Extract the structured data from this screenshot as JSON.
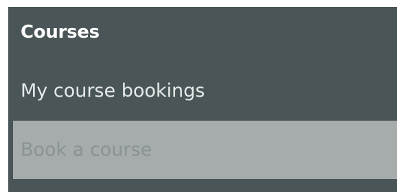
{
  "nav": {
    "heading": "Courses",
    "items": [
      {
        "label": "My course bookings",
        "state": "default"
      },
      {
        "label": "Book a course",
        "state": "selected"
      }
    ]
  },
  "colors": {
    "panel_background": "#4a5557",
    "heading_text": "#ffffff",
    "item_text": "#e6eaea",
    "selected_item_background": "#a5acab",
    "selected_item_text": "#8b9293"
  }
}
